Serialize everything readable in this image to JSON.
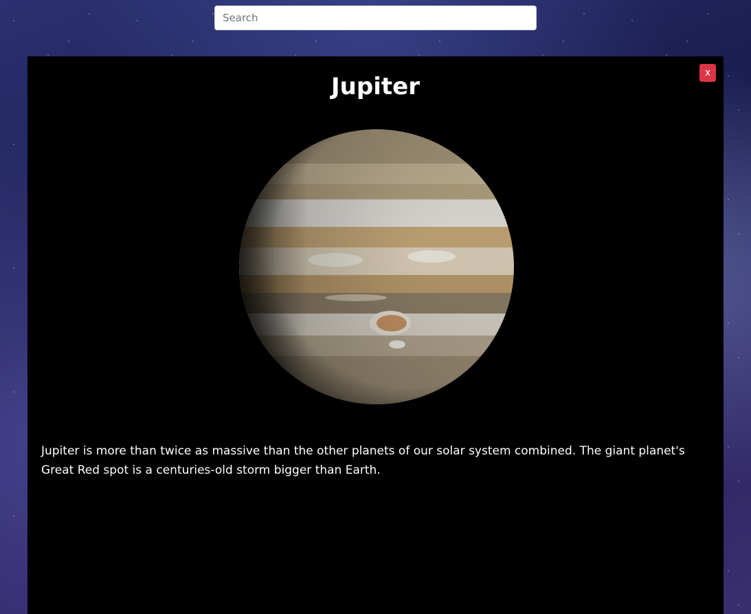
{
  "search": {
    "placeholder": "Search",
    "value": ""
  },
  "modal": {
    "close_label": "x",
    "title": "Jupiter",
    "image_alt": "Jupiter",
    "description": "Jupiter is more than twice as massive than the other planets of our solar system combined. The giant planet's Great Red spot is a centuries-old storm bigger than Earth."
  },
  "colors": {
    "modal_background": "#000000",
    "close_button": "#dc3545",
    "text": "#ffffff"
  }
}
